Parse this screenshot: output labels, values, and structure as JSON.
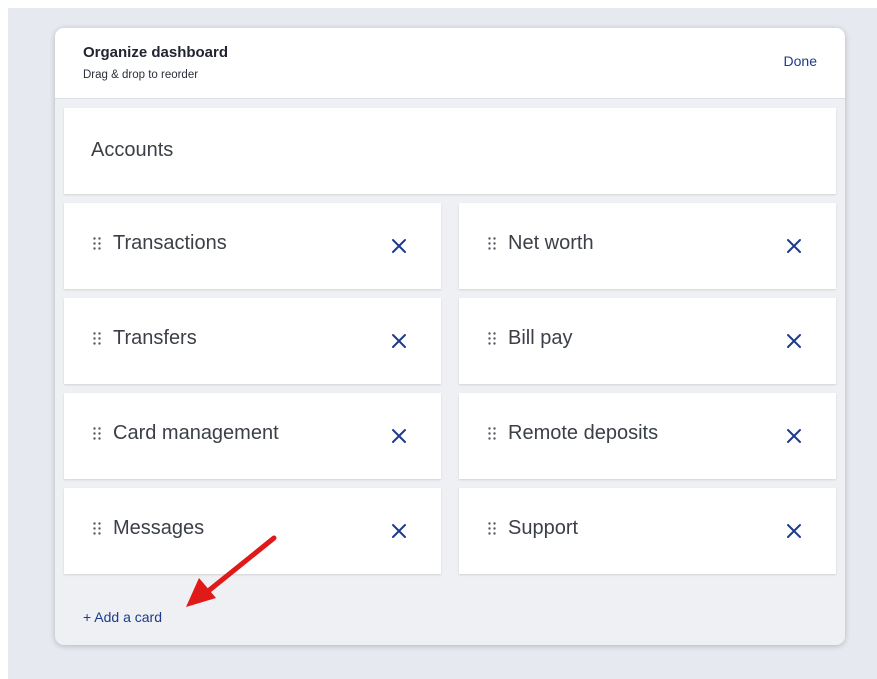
{
  "header": {
    "title": "Organize dashboard",
    "subtitle": "Drag & drop to reorder",
    "done_label": "Done"
  },
  "accounts": {
    "label": "Accounts"
  },
  "cards": [
    {
      "label": "Transactions"
    },
    {
      "label": "Net worth"
    },
    {
      "label": "Transfers"
    },
    {
      "label": "Bill pay"
    },
    {
      "label": "Card management"
    },
    {
      "label": "Remote deposits"
    },
    {
      "label": "Messages"
    },
    {
      "label": "Support"
    }
  ],
  "footer": {
    "add_card_label": "+ Add a card"
  },
  "icons": {
    "drag_handle": "drag-handle-icon",
    "remove": "close-icon",
    "annotation": "red-arrow"
  },
  "colors": {
    "accent": "#1e3a8a",
    "annotation": "#e01919",
    "panel_bg": "#eef0f4",
    "card_bg": "#ffffff"
  }
}
